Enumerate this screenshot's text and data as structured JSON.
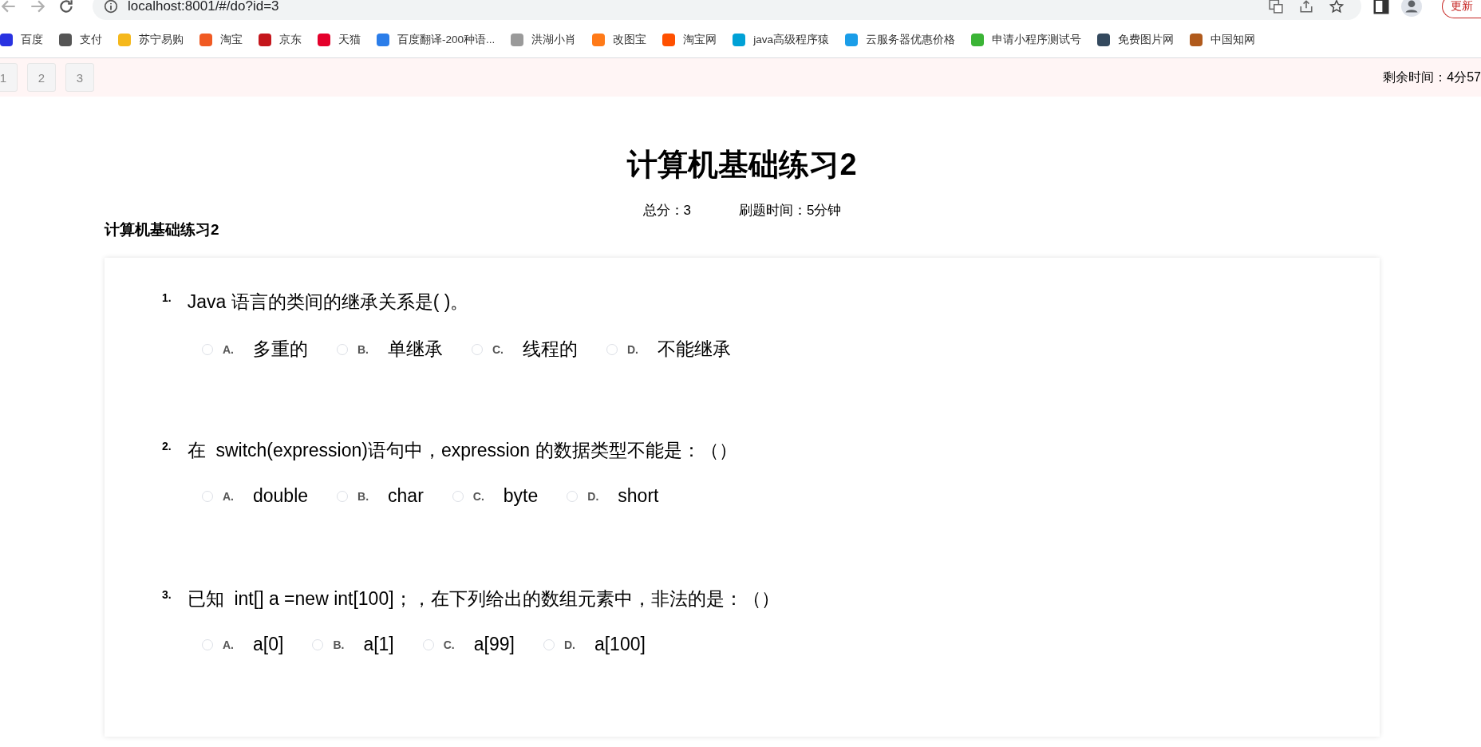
{
  "browser": {
    "url": "localhost:8001/#/do?id=3",
    "update_button": "更新",
    "bookmarks": [
      {
        "label": "百度",
        "color": "#2932e1"
      },
      {
        "label": "支付",
        "color": "#555555"
      },
      {
        "label": "苏宁易购",
        "color": "#f5b81c"
      },
      {
        "label": "淘宝",
        "color": "#f05a23"
      },
      {
        "label": "京东",
        "color": "#c4161c"
      },
      {
        "label": "天猫",
        "color": "#e4002b"
      },
      {
        "label": "百度翻译-200种语...",
        "color": "#2b7de9"
      },
      {
        "label": "洪湖小肖",
        "color": "#9a9a9a"
      },
      {
        "label": "改图宝",
        "color": "#ff7a18"
      },
      {
        "label": "淘宝网",
        "color": "#ff5000"
      },
      {
        "label": "java高级程序猿",
        "color": "#00a1d6"
      },
      {
        "label": "云服务器优惠价格",
        "color": "#1a9de8"
      },
      {
        "label": "申请小程序测试号",
        "color": "#3bb436"
      },
      {
        "label": "免费图片网",
        "color": "#34495e"
      },
      {
        "label": "中国知网",
        "color": "#b05a1c"
      }
    ]
  },
  "nav": {
    "pages": [
      {
        "label": "1",
        "selected": false
      },
      {
        "label": "2",
        "selected": false
      },
      {
        "label": "3",
        "selected": false
      }
    ],
    "remaining_time": "剩余时间：4分57"
  },
  "exam": {
    "title": "计算机基础练习2",
    "total_score": "总分：3",
    "duration": "刷题时间：5分钟",
    "section_title": "计算机基础练习2"
  },
  "questions": [
    {
      "number": "1.",
      "text": "Java 语言的类间的继承关系是( )。",
      "options": [
        {
          "letter": "A.",
          "text": "多重的",
          "selected": false
        },
        {
          "letter": "B.",
          "text": "单继承",
          "selected": false
        },
        {
          "letter": "C.",
          "text": "线程的",
          "selected": false
        },
        {
          "letter": "D.",
          "text": "不能继承",
          "selected": false
        }
      ]
    },
    {
      "number": "2.",
      "text": "在  switch(expression)语句中，expression 的数据类型不能是：（）",
      "options": [
        {
          "letter": "A.",
          "text": "double",
          "selected": false
        },
        {
          "letter": "B.",
          "text": "char",
          "selected": false
        },
        {
          "letter": "C.",
          "text": "byte",
          "selected": false
        },
        {
          "letter": "D.",
          "text": "short",
          "selected": false
        }
      ]
    },
    {
      "number": "3.",
      "text": "已知  int[] a =new int[100]；，在下列给出的数组元素中，非法的是：（）",
      "options": [
        {
          "letter": "A.",
          "text": "a[0]",
          "selected": false
        },
        {
          "letter": "B.",
          "text": "a[1]",
          "selected": false
        },
        {
          "letter": "C.",
          "text": "a[99]",
          "selected": false
        },
        {
          "letter": "D.",
          "text": "a[100]",
          "selected": false
        }
      ]
    }
  ]
}
